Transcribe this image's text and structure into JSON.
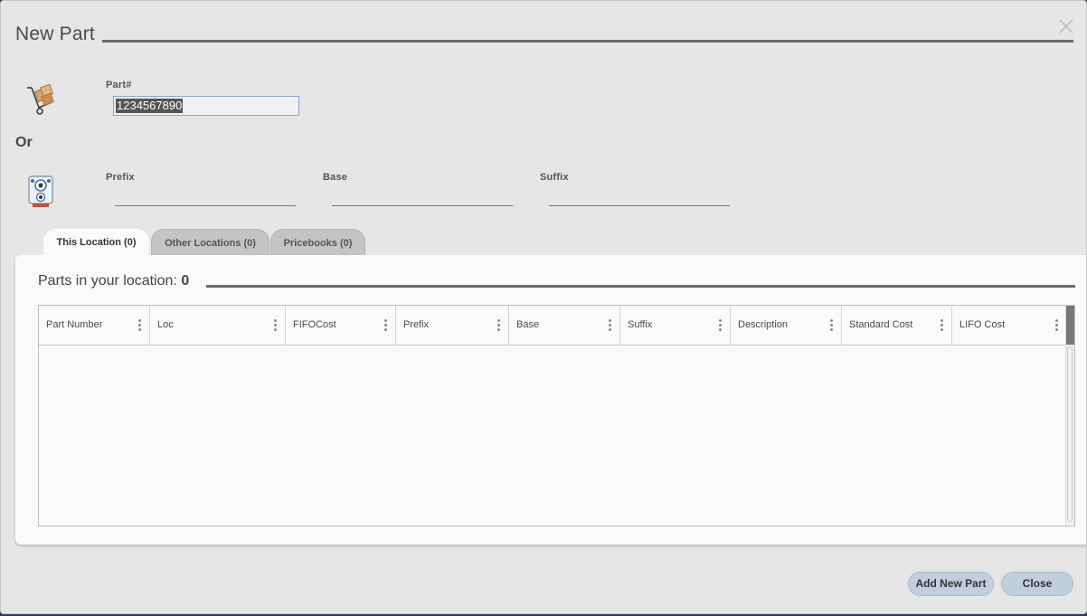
{
  "dialog": {
    "title": "New Part",
    "close_icon": "close-icon"
  },
  "part_number": {
    "label": "Part#",
    "value": "1234567890",
    "icon": "hand-truck-icon"
  },
  "or_label": "Or",
  "split_fields": {
    "icon": "speaker-part-icon",
    "prefix": {
      "label": "Prefix",
      "value": ""
    },
    "base": {
      "label": "Base",
      "value": ""
    },
    "suffix": {
      "label": "Suffix",
      "value": ""
    }
  },
  "tabs": [
    {
      "label": "This Location (0)",
      "active": true
    },
    {
      "label": "Other Locations (0)",
      "active": false
    },
    {
      "label": "Pricebooks (0)",
      "active": false
    }
  ],
  "panel": {
    "title_prefix": "Parts in your location:",
    "count": "0"
  },
  "grid": {
    "columns": [
      "Part Number",
      "Loc",
      "FIFOCost",
      "Prefix",
      "Base",
      "Suffix",
      "Description",
      "Standard Cost",
      "LIFO Cost"
    ],
    "rows": []
  },
  "buttons": {
    "add_new_part": "Add New Part",
    "close": "Close"
  },
  "colors": {
    "dialog_bg": "#e6e6e6",
    "panel_bg": "#fafafa",
    "button_bg": "#c3cedd",
    "rule": "#6a6a6a"
  }
}
